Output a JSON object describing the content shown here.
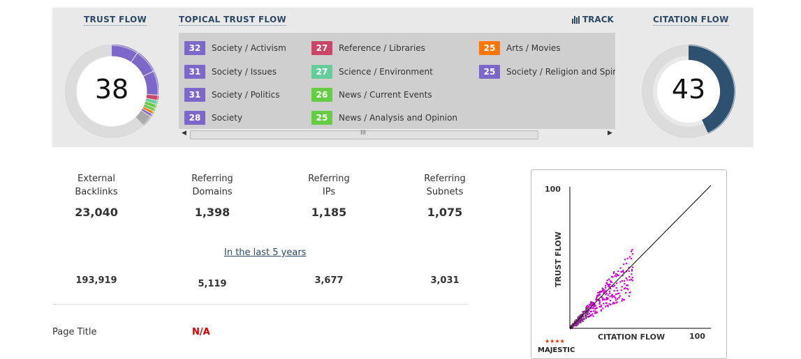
{
  "trust_flow": {
    "header": "TRUST FLOW",
    "value": "38"
  },
  "topical_trust_flow": {
    "header": "TOPICAL TRUST FLOW",
    "track_label": "TRACK",
    "topics": [
      {
        "score": "32",
        "label": "Society / Activism",
        "color": "#7b68c8"
      },
      {
        "score": "31",
        "label": "Society / Issues",
        "color": "#7b68c8"
      },
      {
        "score": "31",
        "label": "Society / Politics",
        "color": "#7b68c8"
      },
      {
        "score": "28",
        "label": "Society",
        "color": "#7b68c8"
      },
      {
        "score": "27",
        "label": "Reference / Libraries",
        "color": "#cc4466"
      },
      {
        "score": "27",
        "label": "Science / Environment",
        "color": "#66cc99"
      },
      {
        "score": "26",
        "label": "News / Current Events",
        "color": "#66cc44"
      },
      {
        "score": "25",
        "label": "News / Analysis and Opinion",
        "color": "#66cc44"
      },
      {
        "score": "25",
        "label": "Arts / Movies",
        "color": "#ff7700"
      },
      {
        "score": "25",
        "label": "Society / Religion and Spirituality",
        "color": "#7b68c8"
      }
    ],
    "scroll_grip": "III"
  },
  "citation_flow": {
    "header": "CITATION FLOW",
    "value": "43",
    "color": "#2e5170",
    "fraction": 0.43
  },
  "stats": [
    {
      "label1": "External",
      "label2": "Backlinks",
      "value": "23,040",
      "historic": "193,919"
    },
    {
      "label1": "Referring",
      "label2": "Domains",
      "value": "1,398",
      "historic": "5,119"
    },
    {
      "label1": "Referring",
      "label2": "IPs",
      "value": "1,185",
      "historic": "3,677"
    },
    {
      "label1": "Referring",
      "label2": "Subnets",
      "value": "1,075",
      "historic": "3,031"
    }
  ],
  "history_link": "In the last 5 years",
  "page_title": {
    "label": "Page Title",
    "value": "N/A"
  },
  "scatter": {
    "y_axis_label": "TRUST FLOW",
    "x_axis_label": "CITATION FLOW",
    "y_max_label": "100",
    "x_max_label": "100",
    "logo": "MAJESTIC",
    "point_color": "#cc00cc"
  }
}
